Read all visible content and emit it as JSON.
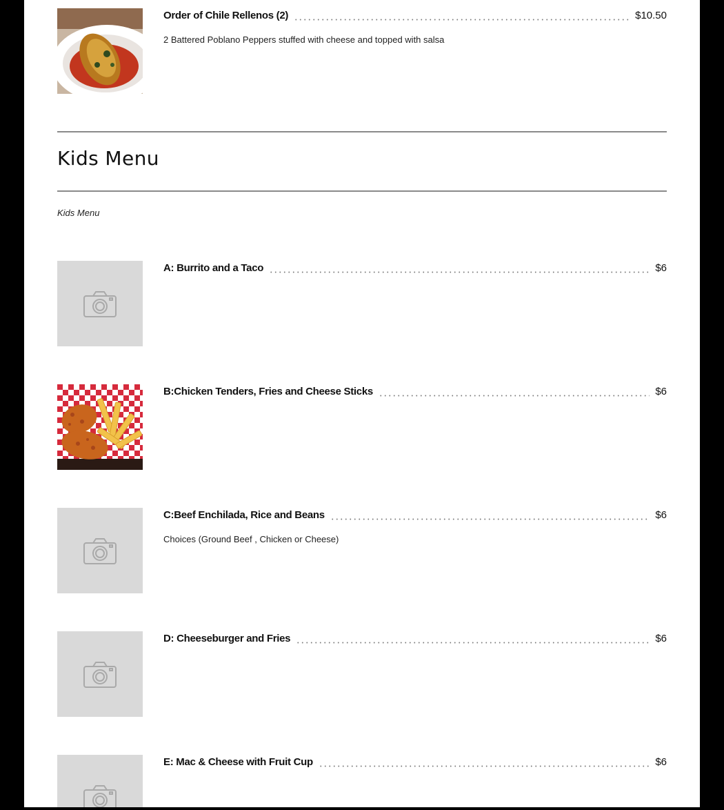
{
  "colors": {
    "backdrop": "#000000",
    "page": "#ffffff",
    "placeholder": "#d9d9d9",
    "rule": "#8a8a8a"
  },
  "previous_item": {
    "name": "Order of Chile Rellenos (2)",
    "price": "$10.50",
    "description": "2 Battered Poblano Peppers stuffed with cheese and topped with salsa",
    "image": "chile-relleno-photo"
  },
  "kids_menu": {
    "title": "Kids Menu",
    "subtitle": "Kids Menu",
    "items": [
      {
        "name": "A: Burrito and a Taco",
        "price": "$6",
        "description": "",
        "image": "camera-placeholder-icon"
      },
      {
        "name": "B:Chicken Tenders, Fries and Cheese Sticks",
        "price": "$6",
        "description": "",
        "image": "chicken-tenders-photo"
      },
      {
        "name": "C:Beef Enchilada, Rice and Beans",
        "price": "$6",
        "description": "Choices (Ground Beef , Chicken or Cheese)",
        "image": "camera-placeholder-icon"
      },
      {
        "name": "D: Cheeseburger and Fries",
        "price": "$6",
        "description": "",
        "image": "camera-placeholder-icon"
      },
      {
        "name": "E: Mac & Cheese with Fruit Cup",
        "price": "$6",
        "description": "",
        "image": "camera-placeholder-icon"
      }
    ]
  }
}
